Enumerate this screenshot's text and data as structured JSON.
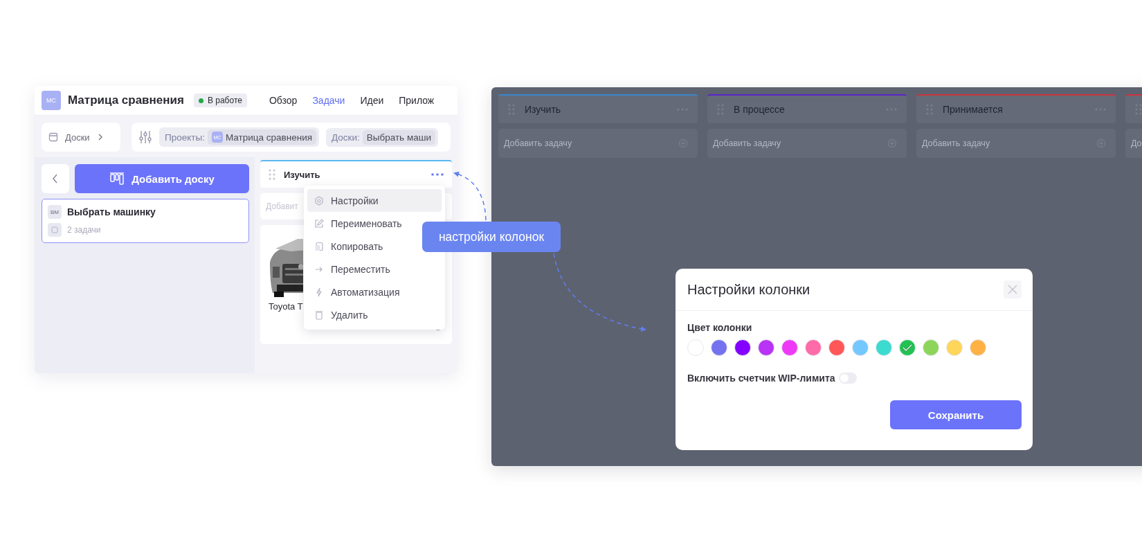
{
  "left_screen": {
    "project": {
      "avatar": "МС",
      "title": "Матрица сравнения",
      "status": "В работе"
    },
    "nav_tabs": [
      {
        "label": "Обзор",
        "selected": false
      },
      {
        "label": "Задачи",
        "selected": true
      },
      {
        "label": "Идеи",
        "selected": false
      },
      {
        "label": "Прилож",
        "selected": false
      }
    ],
    "boards_button": "Доски",
    "filters": [
      {
        "label": "Проекты:",
        "avatar": "МС",
        "value": "Матрица сравнения"
      },
      {
        "label": "Доски:",
        "value": "Выбрать маши"
      }
    ],
    "add_board_button": "Добавить доску",
    "boards": [
      {
        "avatar": "ВМ",
        "name": "Выбрать машинку",
        "count": "2 задачи",
        "selected": true
      }
    ],
    "column": {
      "title": "Изучить",
      "add_task_placeholder": "Добавит",
      "card": {
        "kind": "picture",
        "title": "Toyota T",
        "done": false
      }
    },
    "context_menu": [
      {
        "kind": "gear",
        "label": "Настройки",
        "selected": true
      },
      {
        "kind": "edit",
        "label": "Переименовать",
        "selected": false
      },
      {
        "kind": "copy",
        "label": "Копировать",
        "selected": false
      },
      {
        "kind": "arrow",
        "label": "Переместить",
        "selected": false
      },
      {
        "kind": "bolt",
        "label": "Автоматизация",
        "selected": false
      },
      {
        "kind": "trash",
        "label": "Удалить",
        "selected": false
      }
    ]
  },
  "callout": "настройки колонок",
  "right_screen": {
    "columns": [
      {
        "title": "Изучить",
        "color": "#3a86c8",
        "add_task_placeholder": "Добавить задачу"
      },
      {
        "title": "В процессе",
        "color": "#5a25c9",
        "add_task_placeholder": "Добавить задачу"
      },
      {
        "title": "Принимается",
        "color": "#c8363d",
        "add_task_placeholder": "Добавить задачу"
      },
      {
        "color": "#c8363d",
        "add_task_placeholder": "До"
      }
    ],
    "modal": {
      "title": "Настройки колонки",
      "color_label": "Цвет колонки",
      "colors": [
        {
          "color": "#ffffff",
          "selected": false
        },
        {
          "color": "#7572ef",
          "selected": false
        },
        {
          "color": "#8400ff",
          "selected": false
        },
        {
          "color": "#b833f6",
          "selected": false
        },
        {
          "color": "#ee3af6",
          "selected": false
        },
        {
          "color": "#ff6aa8",
          "selected": false
        },
        {
          "color": "#ff5757",
          "selected": false
        },
        {
          "color": "#75c7ff",
          "selected": false
        },
        {
          "color": "#3cdbcf",
          "selected": false
        },
        {
          "color": "#21c252",
          "selected": true
        },
        {
          "color": "#8dd55a",
          "selected": false
        },
        {
          "color": "#ffd55a",
          "selected": false
        },
        {
          "color": "#ffb144",
          "selected": false
        }
      ],
      "wip_label": "Включить счетчик WIP-лимита",
      "wip_on": false,
      "save_button": "Сохранить"
    }
  }
}
